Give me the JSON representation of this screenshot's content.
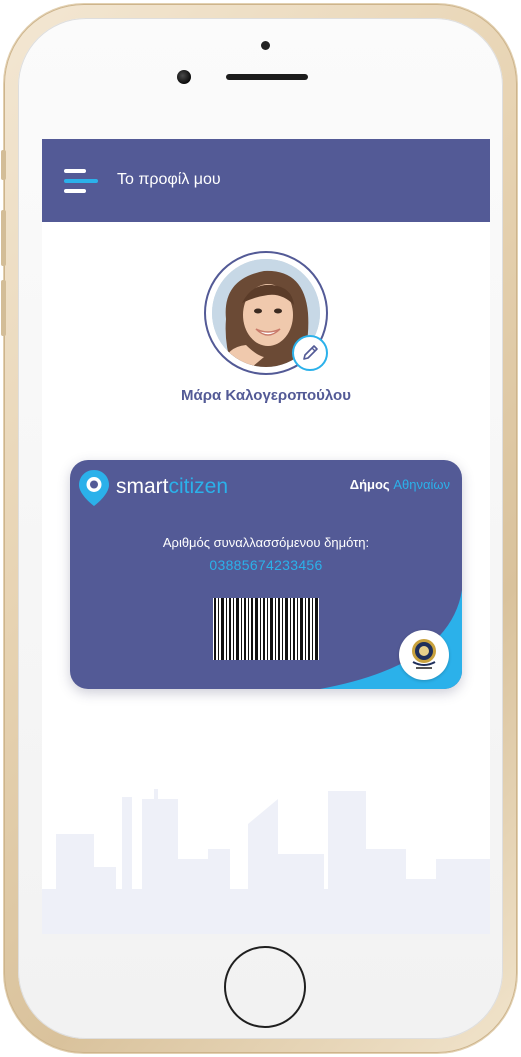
{
  "header": {
    "title": "Το προφίλ μου"
  },
  "profile": {
    "name": "Μάρα Καλογεροπούλου"
  },
  "card": {
    "brand_part1": "smart",
    "brand_part2": "citizen",
    "municipality_part1": "Δήμος",
    "municipality_part2": "Αθηναίων",
    "label": "Αριθμός συναλλασσόμενου δημότη:",
    "number": "03885674233456"
  },
  "colors": {
    "primary": "#535a96",
    "accent": "#2bb1ea",
    "white": "#ffffff"
  },
  "icons": [
    "menu-icon",
    "pencil-icon",
    "location-pin-icon",
    "barcode",
    "municipality-seal"
  ]
}
